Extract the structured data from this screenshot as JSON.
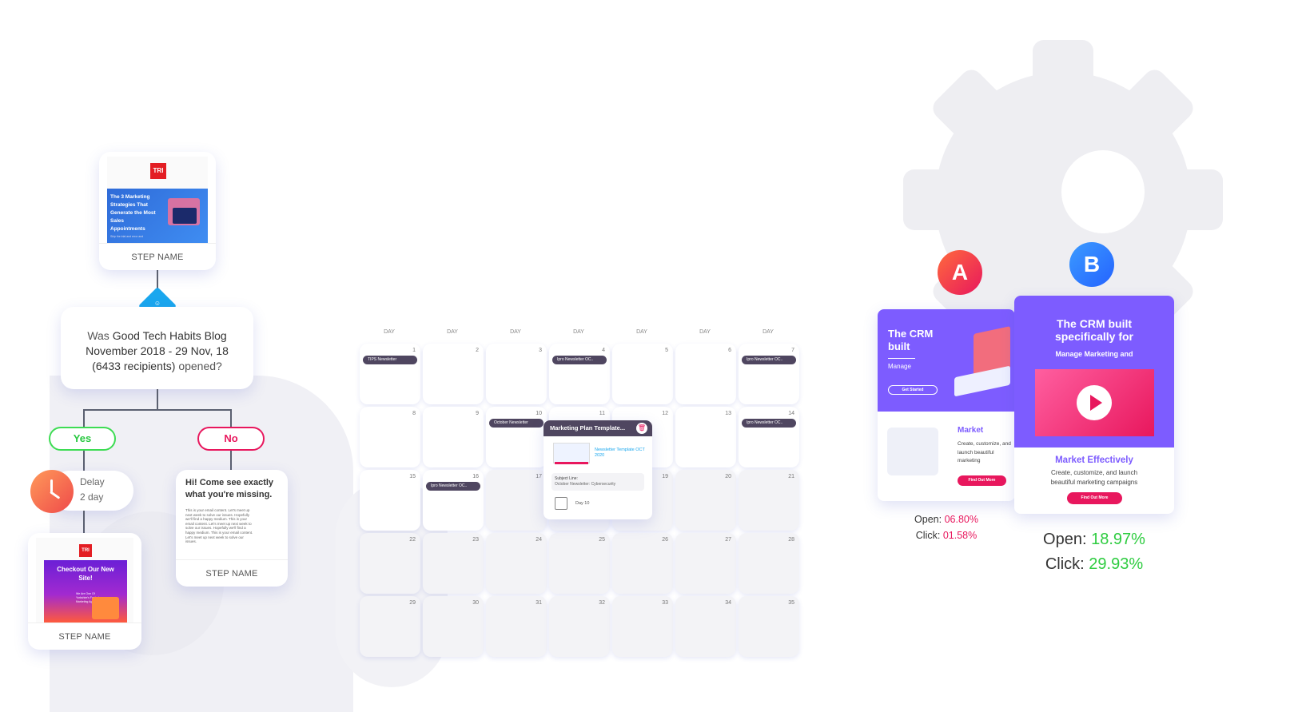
{
  "workflow": {
    "step1": {
      "brand": "TRI",
      "email_headline": "The 3 Marketing Strategies That Generate the Most Sales Appointments",
      "email_subline": "Skip the trial and error and",
      "step_name": "STEP NAME"
    },
    "condition": {
      "prefix": "Was ",
      "subject": "Good Tech Habits Blog November 2018 - 29 Nov, 18 (6433 recipients)",
      "suffix": " opened?"
    },
    "yes_label": "Yes",
    "no_label": "No",
    "delay": {
      "title": "Delay",
      "value": "2 day"
    },
    "step_yes": {
      "brand": "TRI",
      "email_headline": "Checkout Our New Site!",
      "email_body": "We Are One Of Yorkshire's Fastest Marketing Agency",
      "step_name": "STEP NAME"
    },
    "step_no": {
      "headline": "Hi! Come see exactly what you're missing.",
      "body": "This is your email content. Let's meet up next week to solve our issues. Hopefully we'll find a happy medium. This is your email content. Let's meet up next week to solve our issues. Hopefully we'll find a happy medium. This is your email content. Let's meet up next week to solve our issues.",
      "step_name": "STEP NAME"
    }
  },
  "calendar": {
    "day_headers": [
      "DAY",
      "DAY",
      "DAY",
      "DAY",
      "DAY",
      "DAY",
      "DAY"
    ],
    "days": [
      "1",
      "2",
      "3",
      "4",
      "5",
      "6",
      "7",
      "8",
      "9",
      "10",
      "11",
      "12",
      "13",
      "14",
      "15",
      "16",
      "17",
      "18",
      "19",
      "20",
      "21",
      "22",
      "23",
      "24",
      "25",
      "26",
      "27",
      "28",
      "29",
      "30",
      "31",
      "32",
      "33",
      "34",
      "35"
    ],
    "events": [
      {
        "label": "TIPS Newsletter"
      },
      {
        "label": "Ipro Newsletter  OC.."
      },
      {
        "label": "Ipro Newsletter  OC.."
      },
      {
        "label": "October Newsletter"
      },
      {
        "label": "Ipro Newsletter  OC.."
      },
      {
        "label": "Ipro Newsletter  OC.."
      }
    ],
    "popup": {
      "title": "Marketing Plan Template...",
      "template_name": "Newsletter Template OCT 2020",
      "subject_label": "Subject Line:",
      "subject_value": "October Newsletter: Cybersecurity",
      "day_label": "Day 10",
      "accent": "#4f4660"
    }
  },
  "ab_test": {
    "variant_a": {
      "badge": "A",
      "hero_title": "The CRM built",
      "hero_sub": "Manage",
      "cta": "Get Started",
      "section_title": "Market",
      "section_body": "Create, customize, and launch beautiful marketing",
      "section_cta": "Find Out More",
      "open_label": "Open: ",
      "open_value": "06.80%",
      "click_label": "Click: ",
      "click_value": "01.58%",
      "stat_color": "#e8175d"
    },
    "variant_b": {
      "badge": "B",
      "hero_title": "The CRM built specifically for",
      "hero_sub": "Manage Marketing and",
      "section_title": "Market Effectively",
      "section_body": "Create, customize, and launch beautiful marketing campaigns",
      "section_cta": "Find Out More",
      "open_label": "Open: ",
      "open_value": "18.97%",
      "click_label": "Click: ",
      "click_value": "29.93%",
      "stat_color": "#2ecc40"
    },
    "colors": {
      "purple": "#7d5cff",
      "pink": "#e8175d",
      "badge_a": "#ef3340",
      "badge_b": "#2b7fff"
    }
  }
}
